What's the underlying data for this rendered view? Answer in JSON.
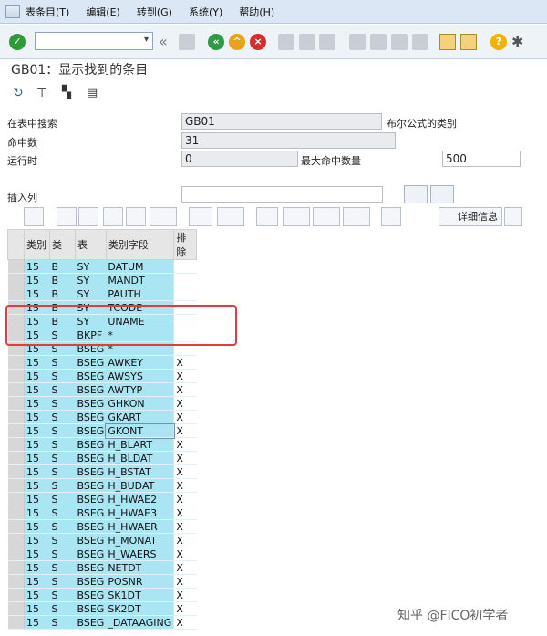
{
  "menubar": {
    "items": [
      "表条目(T)",
      "编辑(E)",
      "转到(G)",
      "系统(Y)",
      "帮助(H)"
    ]
  },
  "toolbar": {
    "icons": [
      "check-icon",
      "command-field",
      "back-icon",
      "save-icon",
      "green-back-icon",
      "exit-icon",
      "cancel-icon",
      "print-icon",
      "find-icon",
      "find-next-icon",
      "first-page-icon",
      "prev-page-icon",
      "next-page-icon",
      "last-page-icon",
      "new-session-icon",
      "shortcut-icon",
      "help-icon",
      "settings-icon"
    ]
  },
  "title": "GB01：显示找到的条目",
  "form": {
    "search_in_table_label": "在表中搜索",
    "search_in_table_value": "GB01",
    "boolean_class_label": "布尔公式的类别",
    "hit_count_label": "命中数",
    "hit_count_value": "31",
    "runtime_label": "运行时",
    "runtime_value": "0",
    "max_hits_label": "最大命中数量",
    "max_hits_value": "500",
    "insert_column_label": "插入列"
  },
  "alv": {
    "details_label": "详细信息"
  },
  "table": {
    "headers": [
      "类别",
      "类",
      "表",
      "类别字段",
      "排除"
    ],
    "rows": [
      [
        "15",
        "B",
        "SY",
        "DATUM",
        ""
      ],
      [
        "15",
        "B",
        "SY",
        "MANDT",
        ""
      ],
      [
        "15",
        "B",
        "SY",
        "PAUTH",
        ""
      ],
      [
        "15",
        "B",
        "SY",
        "TCODE",
        ""
      ],
      [
        "15",
        "B",
        "SY",
        "UNAME",
        ""
      ],
      [
        "15",
        "S",
        "BKPF",
        "*",
        ""
      ],
      [
        "15",
        "S",
        "BSEG",
        "*",
        ""
      ],
      [
        "15",
        "S",
        "BSEG",
        "AWKEY",
        "X"
      ],
      [
        "15",
        "S",
        "BSEG",
        "AWSYS",
        "X"
      ],
      [
        "15",
        "S",
        "BSEG",
        "AWTYP",
        "X"
      ],
      [
        "15",
        "S",
        "BSEG",
        "GHKON",
        "X"
      ],
      [
        "15",
        "S",
        "BSEG",
        "GKART",
        "X"
      ],
      [
        "15",
        "S",
        "BSEG",
        "GKONT",
        "X"
      ],
      [
        "15",
        "S",
        "BSEG",
        "H_BLART",
        "X"
      ],
      [
        "15",
        "S",
        "BSEG",
        "H_BLDAT",
        "X"
      ],
      [
        "15",
        "S",
        "BSEG",
        "H_BSTAT",
        "X"
      ],
      [
        "15",
        "S",
        "BSEG",
        "H_BUDAT",
        "X"
      ],
      [
        "15",
        "S",
        "BSEG",
        "H_HWAE2",
        "X"
      ],
      [
        "15",
        "S",
        "BSEG",
        "H_HWAE3",
        "X"
      ],
      [
        "15",
        "S",
        "BSEG",
        "H_HWAER",
        "X"
      ],
      [
        "15",
        "S",
        "BSEG",
        "H_MONAT",
        "X"
      ],
      [
        "15",
        "S",
        "BSEG",
        "H_WAERS",
        "X"
      ],
      [
        "15",
        "S",
        "BSEG",
        "NETDT",
        "X"
      ],
      [
        "15",
        "S",
        "BSEG",
        "POSNR",
        "X"
      ],
      [
        "15",
        "S",
        "BSEG",
        "SK1DT",
        "X"
      ],
      [
        "15",
        "S",
        "BSEG",
        "SK2DT",
        "X"
      ],
      [
        "15",
        "S",
        "BSEG",
        "_DATAAGING",
        "X"
      ]
    ]
  },
  "watermark": "知乎 @FICO初学者",
  "colors": {
    "row_cyan": "#a9e5f3",
    "highlight_red": "#e83a3a",
    "menubar": "#dbe7f4"
  }
}
